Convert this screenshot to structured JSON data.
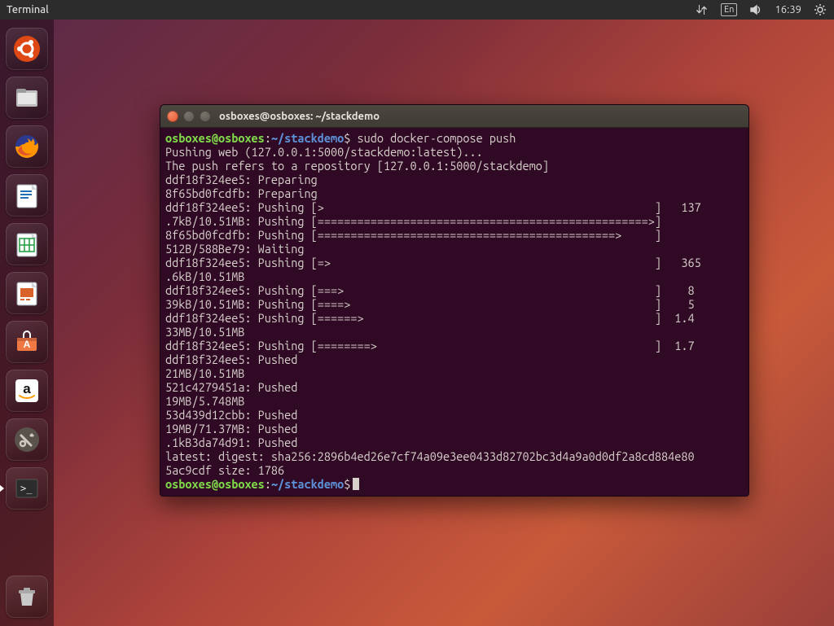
{
  "top_panel": {
    "app_title": "Terminal",
    "lang": "En",
    "time": "16:39"
  },
  "launcher": {
    "items": [
      {
        "name": "ubuntu-dash",
        "bg": "#dd4814"
      },
      {
        "name": "files-nautilus",
        "bg": "#8b8b8b"
      },
      {
        "name": "firefox",
        "bg": "#2b3a55"
      },
      {
        "name": "libreoffice-writer",
        "bg": "#ffffff"
      },
      {
        "name": "libreoffice-calc",
        "bg": "#ffffff"
      },
      {
        "name": "libreoffice-impress",
        "bg": "#ffffff"
      },
      {
        "name": "ubuntu-software",
        "bg": "#ef7843"
      },
      {
        "name": "amazon",
        "bg": "#ffffff"
      },
      {
        "name": "system-settings",
        "bg": "#5a534b"
      },
      {
        "name": "terminal",
        "bg": "#2c2c2c",
        "active": true
      }
    ],
    "trash_name": "trash"
  },
  "window": {
    "title": "osboxes@osboxes: ~/stackdemo"
  },
  "prompt": {
    "user_host": "osboxes@osboxes",
    "colon": ":",
    "path": "~/stackdemo",
    "dollar": "$"
  },
  "command": " sudo docker-compose push",
  "output_lines": [
    "Pushing web (127.0.0.1:5000/stackdemo:latest)...",
    "The push refers to a repository [127.0.0.1:5000/stackdemo]",
    "ddf18f324ee5: Preparing",
    "8f65bd0fcdfb: Preparing",
    "ddf18f324ee5: Pushing [>                                                  ]   137",
    ".7kB/10.51MB: Pushing [==================================================>]",
    "8f65bd0fcdfb: Pushing [=============================================>     ]",
    "512B/588Be79: Waiting",
    "ddf18f324ee5: Pushing [=>                                                 ]   365",
    ".6kB/10.51MB",
    "ddf18f324ee5: Pushing [===>                                               ]    8",
    "39kB/10.51MB: Pushing [====>                                              ]    5",
    "ddf18f324ee5: Pushing [======>                                            ]  1.4",
    "33MB/10.51MB",
    "ddf18f324ee5: Pushing [========>                                          ]  1.7",
    "ddf18f324ee5: Pushed",
    "21MB/10.51MB",
    "521c4279451a: Pushed",
    "19MB/5.748MB",
    "53d439d12cbb: Pushed",
    "19MB/71.37MB: Pushed",
    ".1kB3da74d91: Pushed",
    "latest: digest: sha256:2896b4ed26e7cf74a09e3ee0433d82702bc3d4a9a0d0df2a8cd884e80",
    "5ac9cdf size: 1786"
  ]
}
